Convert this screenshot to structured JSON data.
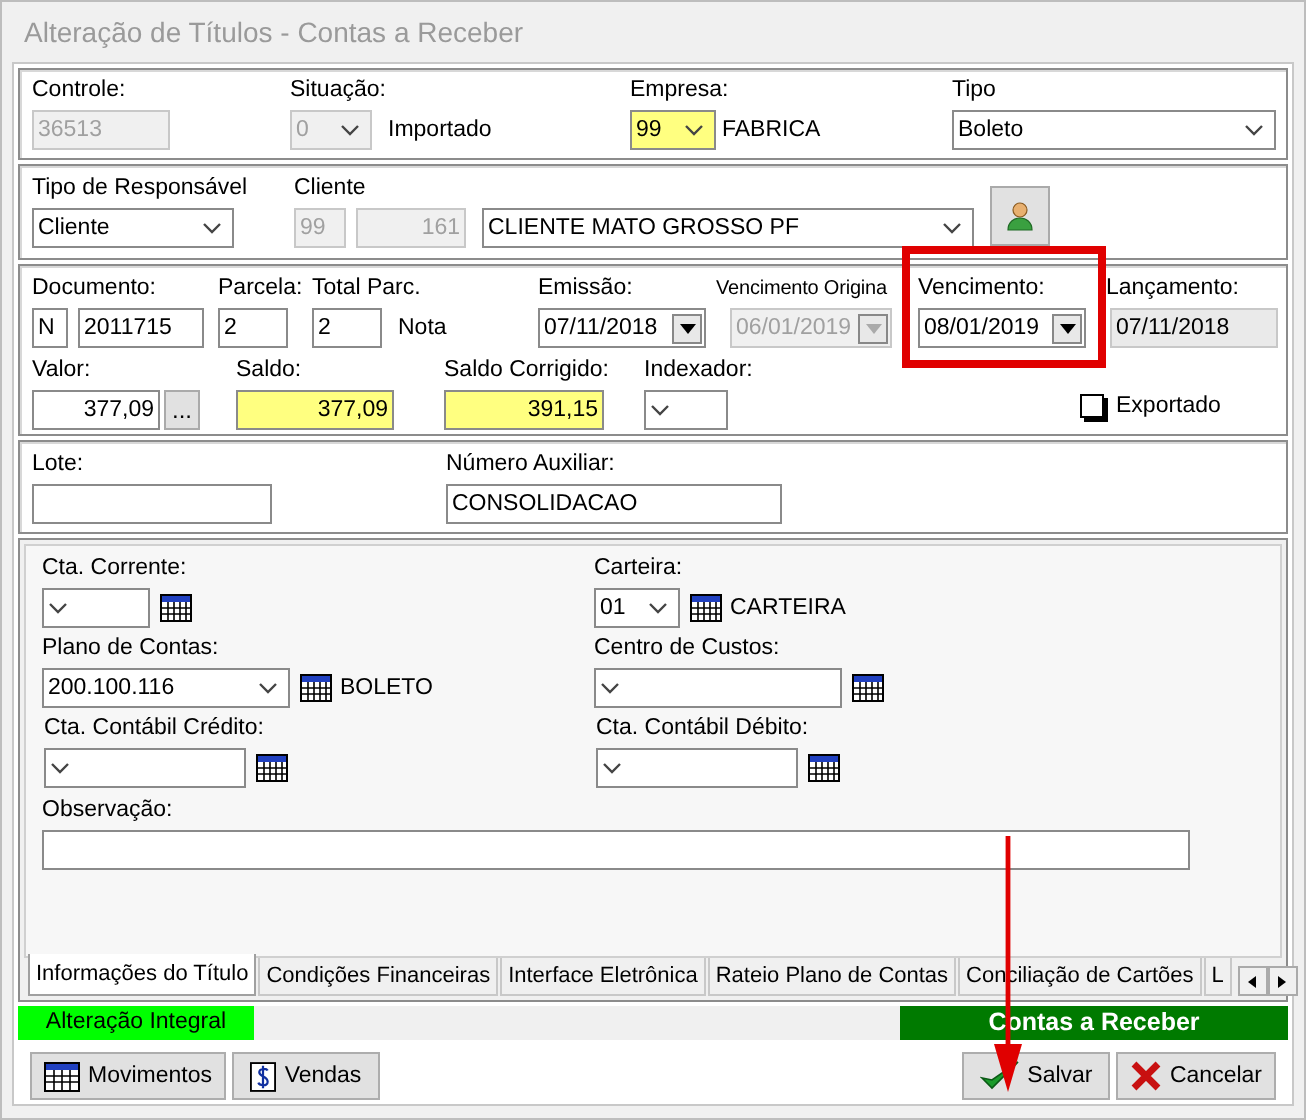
{
  "window": {
    "title": "Alteração de Títulos - Contas a Receber"
  },
  "header": {
    "controle": {
      "label": "Controle:",
      "value": "36513",
      "disabled": true
    },
    "situacao": {
      "label": "Situação:",
      "value": "0",
      "disabled": true,
      "description": "Importado"
    },
    "empresa": {
      "label": "Empresa:",
      "value": "99",
      "highlighted": true,
      "description": "FABRICA"
    },
    "tipo": {
      "label": "Tipo",
      "value": "Boleto"
    }
  },
  "responsavel": {
    "tipo": {
      "label": "Tipo de Responsável",
      "value": "Cliente"
    },
    "cliente": {
      "label": "Cliente",
      "code_1": "99",
      "code_2": "161",
      "name": "CLIENTE MATO GROSSO PF"
    }
  },
  "documento": {
    "documento": {
      "label": "Documento:",
      "prefix": "N",
      "value": "2011715"
    },
    "parcela": {
      "label": "Parcela:",
      "value": "2"
    },
    "total_parc": {
      "label": "Total Parc.",
      "value": "2",
      "description": "Nota"
    },
    "emissao": {
      "label": "Emissão:",
      "value": "07/11/2018",
      "disabled": false
    },
    "vencimento_original": {
      "label": "Vencimento Origina",
      "value": "06/01/2019",
      "disabled": true
    },
    "vencimento": {
      "label": "Vencimento:",
      "value": "08/01/2019",
      "disabled": false
    },
    "lancamento": {
      "label": "Lançamento:",
      "value": "07/11/2018"
    },
    "valor": {
      "label": "Valor:",
      "value": "377,09",
      "button": "..."
    },
    "saldo": {
      "label": "Saldo:",
      "value": "377,09",
      "highlighted": true
    },
    "saldo_corrigido": {
      "label": "Saldo Corrigido:",
      "value": "391,15",
      "highlighted": true
    },
    "indexador": {
      "label": "Indexador:"
    },
    "exportado": {
      "label": "Exportado",
      "checked": false
    }
  },
  "lote": {
    "lote": {
      "label": "Lote:"
    },
    "numero_auxiliar": {
      "label": "Número Auxiliar:",
      "value": "CONSOLIDACAO"
    }
  },
  "tab_page": {
    "cta_corrente": {
      "label": "Cta. Corrente:"
    },
    "carteira": {
      "label": "Carteira:",
      "value": "01",
      "description": "CARTEIRA"
    },
    "plano_de_contas": {
      "label": "Plano de Contas:",
      "value": "200.100.116",
      "description": "BOLETO"
    },
    "centro_de_custos": {
      "label": "Centro de Custos:"
    },
    "cta_contabil_credito": {
      "label": "Cta. Contábil Crédito:"
    },
    "cta_contabil_debito": {
      "label": "Cta. Contábil Débito:"
    },
    "observacao": {
      "label": "Observação:"
    }
  },
  "tabs": [
    {
      "label": "Informações do Título",
      "selected": true
    },
    {
      "label": "Condições Financeiras",
      "selected": false
    },
    {
      "label": "Interface Eletrônica",
      "selected": false
    },
    {
      "label": "Rateio Plano de Contas",
      "selected": false
    },
    {
      "label": "Conciliação de Cartões",
      "selected": false
    },
    {
      "label": "L",
      "selected": false
    }
  ],
  "status": {
    "mode": "Alteração Integral",
    "module": "Contas a Receber"
  },
  "buttons": [
    {
      "label": "Movimentos",
      "kind": "calendar"
    },
    {
      "label": "Vendas",
      "kind": "dollar"
    },
    {
      "label": "Salvar",
      "kind": "check"
    },
    {
      "label": "Cancelar",
      "kind": "cross"
    }
  ]
}
